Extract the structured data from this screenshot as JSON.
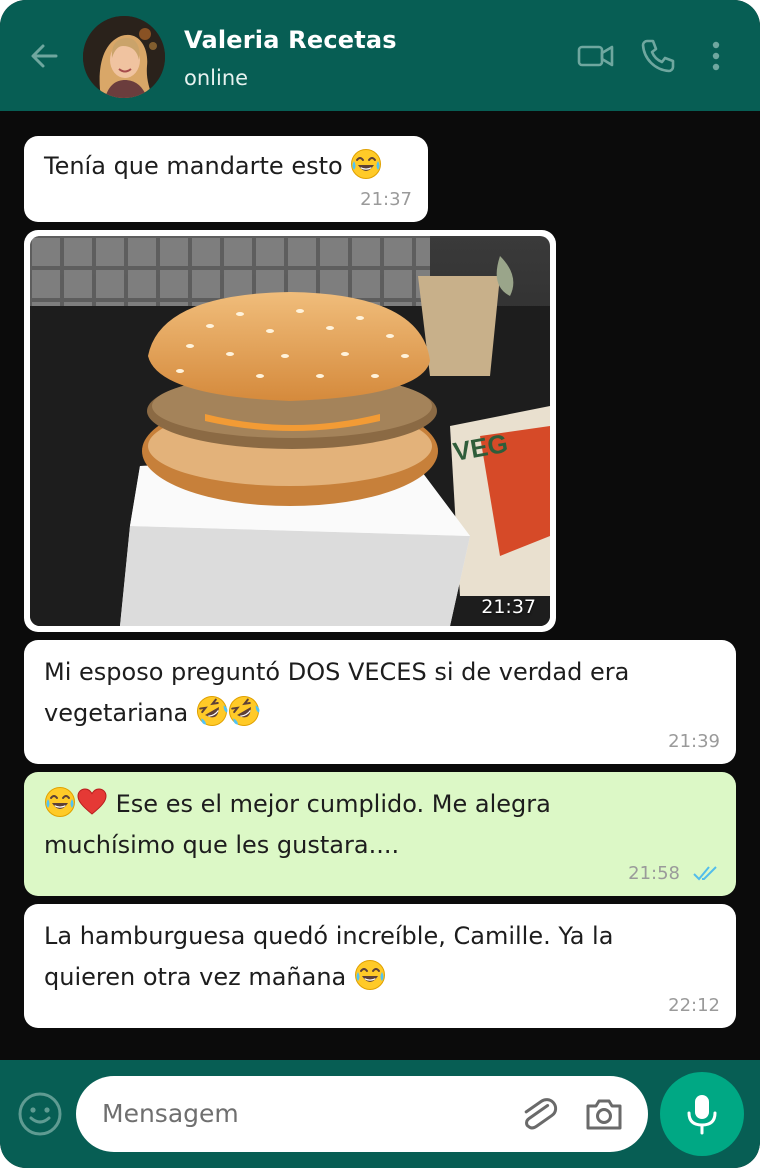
{
  "header": {
    "contact_name": "Valeria Recetas",
    "status": "online",
    "icons": [
      "back-arrow-icon",
      "video-call-icon",
      "voice-call-icon",
      "more-options-icon"
    ]
  },
  "messages": [
    {
      "direction": "incoming",
      "text": "Tenía que mandarte esto",
      "emoji": [
        "face-with-tears-of-joy"
      ],
      "time": "21:37"
    },
    {
      "direction": "incoming",
      "type": "image",
      "image": "veggie-burger-photo",
      "time": "21:37"
    },
    {
      "direction": "incoming",
      "line1": "Mi esposo preguntó DOS VECES si de verdad era",
      "line2": "vegetariana",
      "emoji": [
        "rolling-on-floor-laughing",
        "rolling-on-floor-laughing"
      ],
      "time": "21:39"
    },
    {
      "direction": "outgoing",
      "line1": "Ese es el mejor cumplido. Me alegra",
      "line2": "muchísimo que les gustara....",
      "emoji": [
        "face-with-tears-of-joy",
        "red-heart"
      ],
      "time": "21:58",
      "status": "read"
    },
    {
      "direction": "incoming",
      "line1": "La hamburguesa quedó increíble, Camille. Ya la",
      "line2": "quieren otra vez mañana",
      "emoji": [
        "face-with-tears-of-joy"
      ],
      "time": "22:12"
    }
  ],
  "composer": {
    "placeholder": "Mensagem",
    "icons": [
      "emoji-icon",
      "attach-icon",
      "camera-icon",
      "microphone-icon"
    ]
  },
  "colors": {
    "header": "#075e54",
    "chat_background": "#0b0b0b",
    "incoming_bubble": "#ffffff",
    "outgoing_bubble": "#dcf8c6",
    "send_button": "#00a884",
    "read_ticks": "#53bdeb"
  }
}
